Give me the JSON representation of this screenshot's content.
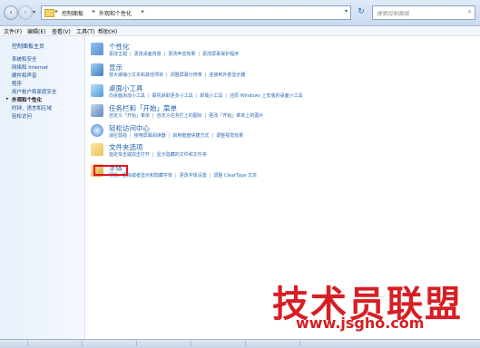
{
  "address": {
    "crumbs": [
      "控制面板",
      "外观和个性化"
    ],
    "search_placeholder": "搜索控制面板"
  },
  "menu": [
    "文件(F)",
    "编辑(E)",
    "查看(V)",
    "工具(T)",
    "帮助(H)"
  ],
  "left_pane": {
    "home": "控制面板主页",
    "items": [
      "系统和安全",
      "网络和 Internet",
      "硬件和声音",
      "程序",
      "用户帐户和家庭安全",
      "外观和个性化",
      "时钟、语言和区域",
      "轻松访问"
    ],
    "active_index": 5
  },
  "categories": [
    {
      "title": "个性化",
      "links": [
        "更改主题",
        "更改桌面背景",
        "更改声音效果",
        "更改屏幕保护程序"
      ]
    },
    {
      "title": "显示",
      "links": [
        "放大或缩小文本和其他项目",
        "调整屏幕分辨率",
        "连接到外部显示器"
      ]
    },
    {
      "title": "桌面小工具",
      "links": [
        "向桌面添加小工具",
        "联机获取更多小工具",
        "卸载小工具",
        "还原 Windows 上安装的桌面小工具"
      ]
    },
    {
      "title": "任务栏和「开始」菜单",
      "links": [
        "自定义「开始」菜单",
        "自定义任务栏上的图标",
        "更改「开始」菜单上的图片"
      ]
    },
    {
      "title": "轻松访问中心",
      "links": [
        "适应弱视",
        "使用屏幕阅读器",
        "启用键盘快捷方式",
        "调整视觉效果"
      ]
    },
    {
      "title": "文件夹选项",
      "links": [
        "指定单击或双击打开",
        "显示隐藏的文件和文件夹"
      ]
    },
    {
      "title": "字体",
      "links": [
        "预览、删除或者显示和隐藏字体",
        "更改字体设置",
        "调整 ClearType 文本"
      ]
    }
  ],
  "icon_colors": [
    "#5b8fd0",
    "#3f7cc4",
    "#4f9bd8",
    "#5a87c0",
    "#3d7fd0",
    "#e8c45a",
    "#d9a83a"
  ],
  "watermark": {
    "text": "技术员联盟",
    "url": "www.jsgho.com"
  },
  "accent": "#e0171e"
}
